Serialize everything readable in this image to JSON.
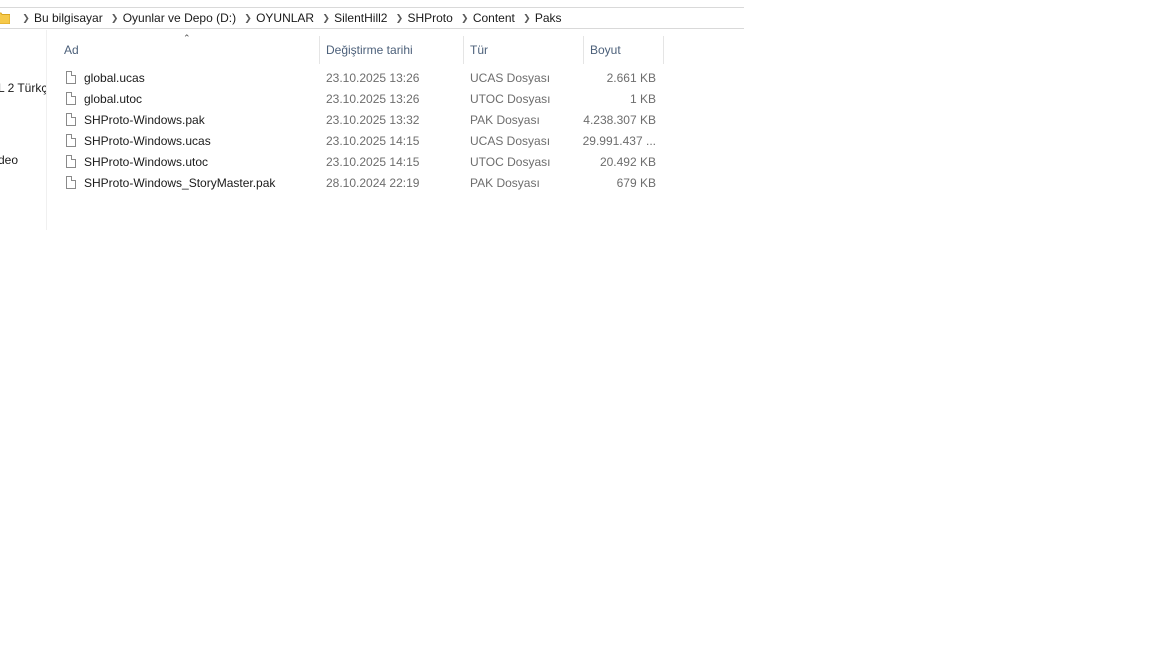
{
  "address_bar": {
    "crumbs": [
      "Bu bilgisayar",
      "Oyunlar ve Depo (D:)",
      "OYUNLAR",
      "SilentHill2",
      "SHProto",
      "Content",
      "Paks"
    ]
  },
  "nav_pane": {
    "items": [
      "L 2 Türkç",
      "deo"
    ]
  },
  "columns": {
    "name": "Ad",
    "date": "Değiştirme tarihi",
    "type": "Tür",
    "size": "Boyut"
  },
  "files": [
    {
      "name": "global.ucas",
      "date": "23.10.2025 13:26",
      "type": "UCAS Dosyası",
      "size": "2.661 KB"
    },
    {
      "name": "global.utoc",
      "date": "23.10.2025 13:26",
      "type": "UTOC Dosyası",
      "size": "1 KB"
    },
    {
      "name": "SHProto-Windows.pak",
      "date": "23.10.2025 13:32",
      "type": "PAK Dosyası",
      "size": "4.238.307 KB"
    },
    {
      "name": "SHProto-Windows.ucas",
      "date": "23.10.2025 14:15",
      "type": "UCAS Dosyası",
      "size": "29.991.437 ..."
    },
    {
      "name": "SHProto-Windows.utoc",
      "date": "23.10.2025 14:15",
      "type": "UTOC Dosyası",
      "size": "20.492 KB"
    },
    {
      "name": "SHProto-Windows_StoryMaster.pak",
      "date": "28.10.2024 22:19",
      "type": "PAK Dosyası",
      "size": "679 KB"
    }
  ],
  "icons": {
    "folder": "folder-icon",
    "file": "file-icon",
    "separator": "chevron-right-icon",
    "sort": "sort-up-icon"
  },
  "colors": {
    "folder": "#f6c94a",
    "header_text": "#4c607a",
    "secondary_text": "#6d6d6d"
  }
}
